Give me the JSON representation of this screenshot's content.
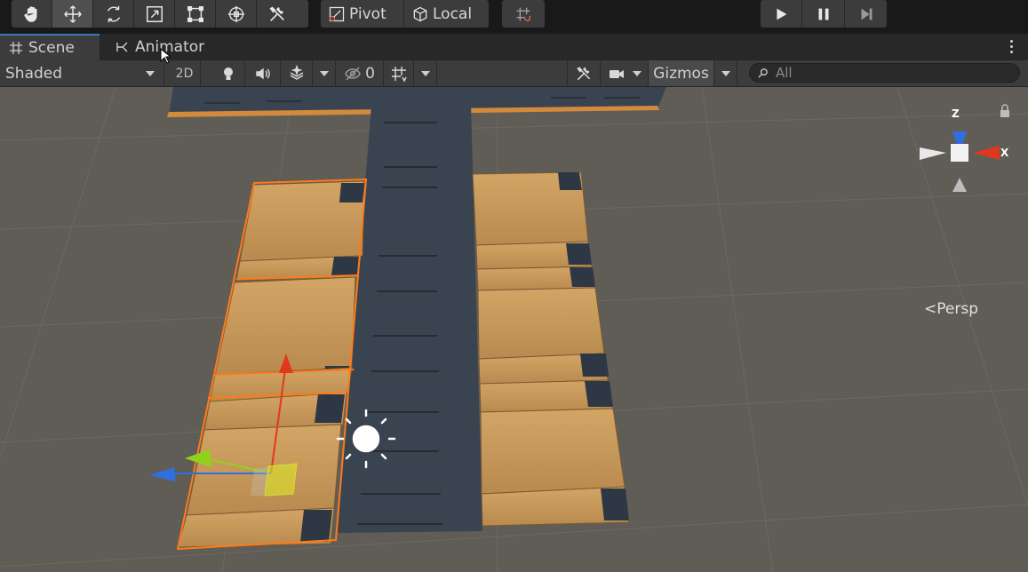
{
  "toolbar": {
    "tools": [
      {
        "name": "hand-tool",
        "icon": "hand-icon",
        "active": false
      },
      {
        "name": "move-tool",
        "icon": "move-arrows-icon",
        "active": true
      },
      {
        "name": "rotate-tool",
        "icon": "rotate-icon",
        "active": false
      },
      {
        "name": "scale-tool",
        "icon": "scale-icon",
        "active": false
      },
      {
        "name": "rect-tool",
        "icon": "rect-transform-icon",
        "active": false
      },
      {
        "name": "transform-tool",
        "icon": "transform-icon",
        "active": false
      },
      {
        "name": "custom-tool",
        "icon": "tools-icon",
        "active": false
      }
    ],
    "pivot_label": "Pivot",
    "local_label": "Local",
    "snap_icon": "grid-snap-icon",
    "play_icon": "play-icon",
    "pause_icon": "pause-icon",
    "step_icon": "step-icon"
  },
  "tabs": [
    {
      "label": "Scene",
      "icon": "scene-grid-icon",
      "active": true
    },
    {
      "label": "Animator",
      "icon": "animator-icon",
      "active": false
    }
  ],
  "scene_toolbar": {
    "draw_mode": "Shaded",
    "mode_2d": "2D",
    "hidden_count": "0",
    "gizmos_label": "Gizmos",
    "search_placeholder": "All"
  },
  "viewport": {
    "gizmo_axes": {
      "z": "Z",
      "x": "X"
    },
    "projection_label": "Persp",
    "colors": {
      "background": "#605d57",
      "selection": "#ff7a1a",
      "plank": "#c2955a",
      "road": "#3a4350",
      "axis_x": "#e0381c",
      "axis_y": "#8fd21c",
      "axis_z": "#2f6fe0"
    }
  }
}
